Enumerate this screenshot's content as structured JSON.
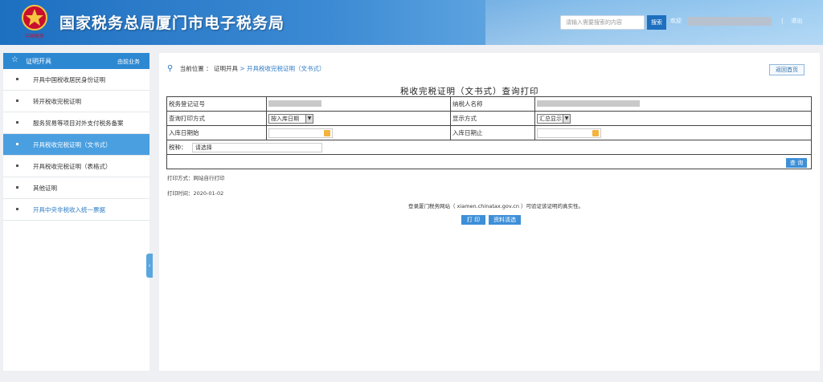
{
  "header": {
    "title": "国家税务总局厦门市电子税务局",
    "emblem_caption": "中国税务",
    "search_placeholder": "请输入需要搜索的内容",
    "search_button": "搜索",
    "welcome": "欢迎",
    "separator": "|",
    "logout": "退出"
  },
  "sidebar": {
    "title": "证明开具",
    "cancel_label": "由前业务",
    "collapse_glyph": "‹",
    "items": [
      {
        "label": "开具中国税收居民身份证明"
      },
      {
        "label": "转开税收完税证明"
      },
      {
        "label": "服务贸易等项目对外支付税务备案"
      },
      {
        "label": "开具税收完税证明（文书式）"
      },
      {
        "label": "开具税收完税证明（表格式）"
      },
      {
        "label": "其他证明"
      },
      {
        "label": "开具中央非税收入统一票据"
      }
    ]
  },
  "breadcrumb": {
    "label": "当前位置 ：",
    "root": "证明开具",
    "current": "> 开具税收完税证明（文书式）"
  },
  "back_button": "返回首页",
  "form": {
    "title": "税收完税证明（文书式）查询打印",
    "tax_reg_no_label": "税务登记证号",
    "taxpayer_name_label": "纳税人名称",
    "query_mode_label": "查询打印方式",
    "query_mode_value": "按入库日期",
    "display_mode_label": "显示方式",
    "display_mode_value": "汇总显示",
    "start_date_label": "入库日期始",
    "end_date_label": "入库日期止",
    "tax_type_label": "税种：",
    "tax_type_value": "请选择",
    "query_button": "查 询"
  },
  "notes": {
    "print_mode": "打印方式：网站自行打印",
    "print_time": "打印时间：2020-01-02",
    "verify": "登录厦门税务网站（ xiamen.chinatax.gov.cn ）可验证该证明的真实性。"
  },
  "buttons": {
    "print": "打 印",
    "reset": "资料清选"
  },
  "colors": {
    "header_blue": "#1d6fc0",
    "active_item": "#4a9fe0",
    "button_blue": "#3d8fd8"
  }
}
